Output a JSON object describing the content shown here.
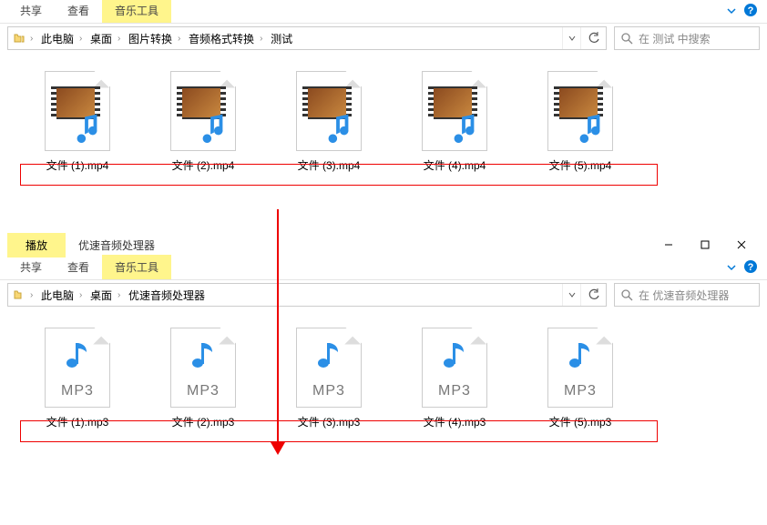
{
  "window1": {
    "tabs": {
      "share": "共享",
      "view": "查看",
      "music_tools": "音乐工具"
    },
    "breadcrumb": [
      "此电脑",
      "桌面",
      "图片转换",
      "音频格式转换",
      "测试"
    ],
    "search_placeholder": "在 测试 中搜索",
    "files": [
      {
        "name": "文件 (1).mp4"
      },
      {
        "name": "文件 (2).mp4"
      },
      {
        "name": "文件 (3).mp4"
      },
      {
        "name": "文件 (4).mp4"
      },
      {
        "name": "文件 (5).mp4"
      }
    ]
  },
  "window2": {
    "titlebar": {
      "play": "播放",
      "app": "优速音频处理器"
    },
    "tabs": {
      "share": "共享",
      "view": "查看",
      "music_tools": "音乐工具"
    },
    "breadcrumb": [
      "此电脑",
      "桌面",
      "优速音频处理器"
    ],
    "search_placeholder": "在 优速音频处理器 ",
    "mp3_label": "MP3",
    "files": [
      {
        "name": "文件 (1).mp3"
      },
      {
        "name": "文件 (2).mp3"
      },
      {
        "name": "文件 (3).mp3"
      },
      {
        "name": "文件 (4).mp3"
      },
      {
        "name": "文件 (5).mp3"
      }
    ]
  }
}
